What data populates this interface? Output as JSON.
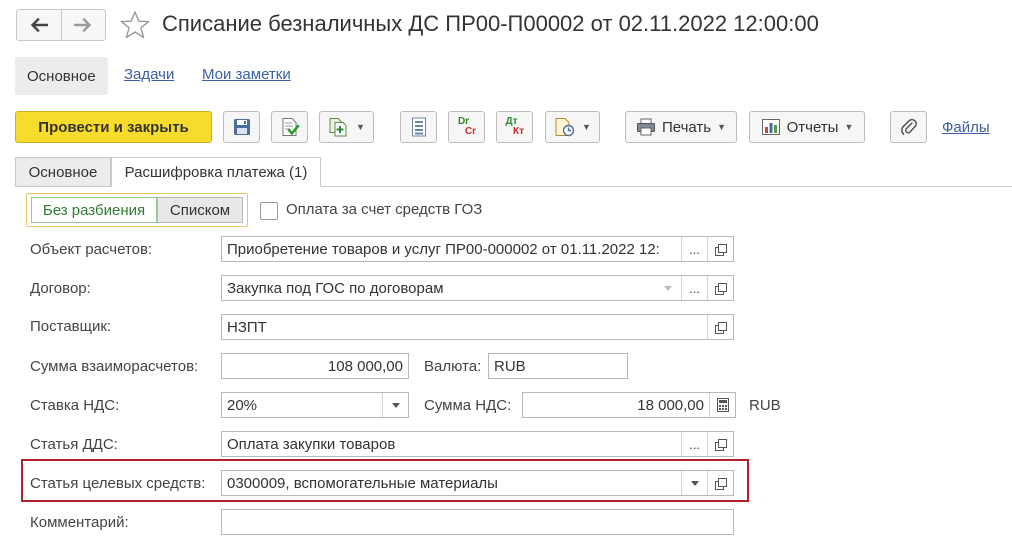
{
  "window": {
    "title": "Списание безналичных ДС ПР00-П00002 от 02.11.2022 12:00:00"
  },
  "icons": {
    "back": "arrow-left-icon",
    "forward": "arrow-right-icon",
    "favorite": "star-icon"
  },
  "section_nav": {
    "main": "Основное",
    "tasks": "Задачи",
    "notes": "Мои заметки"
  },
  "toolbar": {
    "post_and_close": "Провести и закрыть",
    "print": "Печать",
    "reports": "Отчеты",
    "files": "Файлы",
    "dr_top": "Dr",
    "dr_bottom": "Cr",
    "dt_top": "Дт",
    "dt_bottom": "Кт"
  },
  "tabs": [
    {
      "label": "Основное"
    },
    {
      "label": "Расшифровка платежа (1)"
    }
  ],
  "split": {
    "no_split": "Без разбиения",
    "as_list": "Списком"
  },
  "goz_checkbox": {
    "label": "Оплата за счет средств ГОЗ",
    "checked": false
  },
  "form": {
    "settlement_object": {
      "label": "Объект расчетов:",
      "value": "Приобретение товаров и услуг ПР00-000002 от 01.11.2022 12:"
    },
    "contract": {
      "label": "Договор:",
      "value": "Закупка под ГОС по договорам"
    },
    "supplier": {
      "label": "Поставщик:",
      "value": "НЗПТ"
    },
    "settlement_amount": {
      "label": "Сумма взаиморасчетов:",
      "value": "108 000,00"
    },
    "currency": {
      "label": "Валюта:",
      "value": "RUB"
    },
    "vat_rate": {
      "label": "Ставка НДС:",
      "value": "20%"
    },
    "vat_amount": {
      "label": "Сумма НДС:",
      "value": "18 000,00",
      "unit": "RUB"
    },
    "cash_flow_item": {
      "label": "Статья ДДС:",
      "value": "Оплата закупки товаров"
    },
    "target_funds_item": {
      "label": "Статья целевых средств:",
      "value": "0300009, вспомогательные материалы"
    },
    "comment": {
      "label": "Комментарий:",
      "value": ""
    }
  },
  "colors": {
    "primary_button": "#f8dc2b",
    "link": "#3b5fa0",
    "highlight_frame": "#b3202a",
    "active_segment_text": "#2f7d32"
  }
}
